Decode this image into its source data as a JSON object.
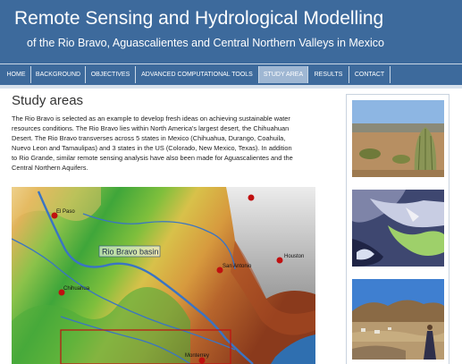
{
  "header": {
    "title": "Remote Sensing and Hydrological Modelling",
    "subtitle": "of the Rio Bravo, Aguascalientes and Central Northern Valleys in Mexico"
  },
  "nav": {
    "items": [
      "HOME",
      "BACKGROUND",
      "OBJECTIVES",
      "ADVANCED COMPUTATIONAL TOOLS",
      "STUDY AREA",
      "RESULTS",
      "CONTACT"
    ],
    "active": "STUDY AREA"
  },
  "main": {
    "heading": "Study areas",
    "paragraph_lines": [
      "The Rio Bravo is selected as an example to develop fresh ideas on achieving sustainable water",
      "resources conditions. The Rio Bravo lies within North America's largest desert, the Chihuahuan",
      "Desert. The Rio Bravo transverses across 5 states in Mexico (Chihuahua, Durango, Coahuila,",
      "Nuevo Leon and Tamaulipas) and 3 states in the US (Colorado, New Mexico, Texas). In addition",
      "to Rio Grande, similar remote sensing analysis have also been made for Aguascalientes and the",
      "Central Northern Aquifers."
    ]
  },
  "map": {
    "basin_label": "Rio Bravo basin",
    "cities": [
      "El Paso",
      "San Antonio",
      "Houston",
      "Chihuahua",
      "Monterrey"
    ],
    "marker_color": "#c01010"
  },
  "sidebar": {
    "photos": [
      "desert-cactus-photo",
      "satellite-image-photo",
      "valley-landscape-photo"
    ]
  },
  "colors": {
    "header_blue": "#3d6a9c",
    "active_tab": "#9fb7d3"
  }
}
